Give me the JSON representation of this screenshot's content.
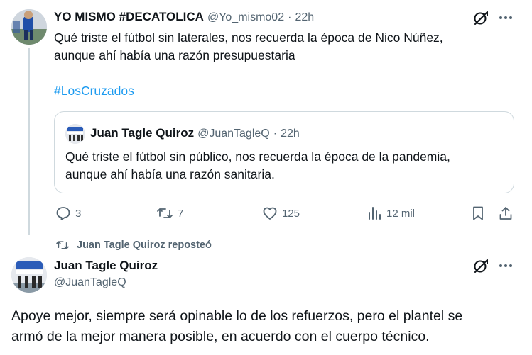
{
  "tweet1": {
    "author_name": "YO MISMO #DECATOLICA",
    "handle": "@Yo_mismo02",
    "separator": "·",
    "time": "22h",
    "text_line1": "Qué triste el fútbol sin laterales, nos recuerda la época de Nico Núñez,",
    "text_line2": "aunque ahí había una razón presupuestaria",
    "hashtag": "#LosCruzados",
    "quote": {
      "author_name": "Juan Tagle Quiroz",
      "handle": "@JuanTagleQ",
      "separator": "·",
      "time": "22h",
      "text_line1": "Qué triste el fútbol sin público, nos recuerda la época de la pandemia,",
      "text_line2": "aunque ahí había una razón sanitaria."
    },
    "actions": {
      "replies": "3",
      "reposts": "7",
      "likes": "125",
      "views": "12 mil"
    }
  },
  "tweet2": {
    "repost_label": "Juan Tagle Quiroz reposteó",
    "author_name": "Juan Tagle Quiroz",
    "handle": "@JuanTagleQ",
    "text_line1": "Apoye mejor, siempre será opinable lo de los refuerzos, pero el plantel se",
    "text_line2": "armó de la mejor manera posible, en acuerdo con el cuerpo técnico."
  },
  "colors": {
    "accent": "#1d9bf0",
    "muted": "#536471",
    "border": "#cfd9de"
  },
  "icons": [
    "grok-icon",
    "more-icon",
    "reply-icon",
    "repost-icon",
    "like-icon",
    "views-icon",
    "bookmark-icon",
    "share-icon"
  ]
}
